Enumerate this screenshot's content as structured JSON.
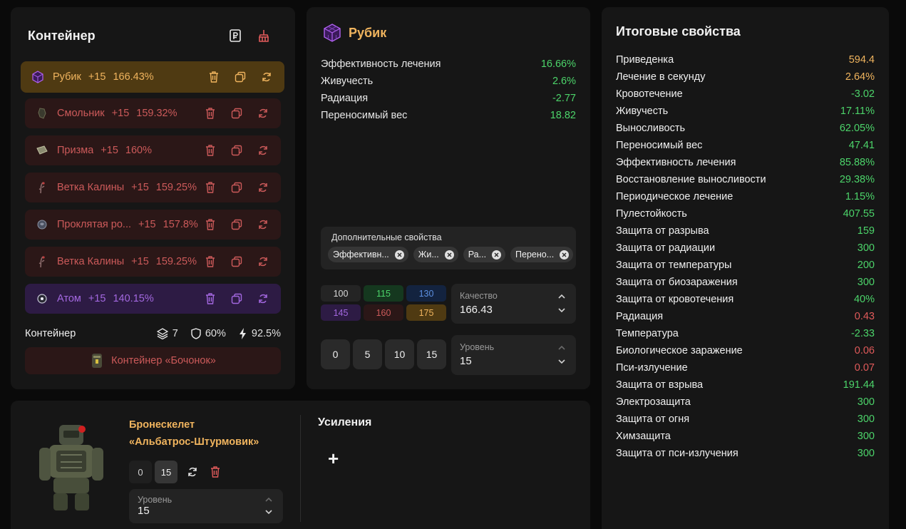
{
  "container": {
    "title": "Контейнер",
    "artifacts": [
      {
        "name": "Рубик",
        "level": "+15",
        "quality": "166.43%",
        "style": "sel",
        "icon": "cube-artifact-icon"
      },
      {
        "name": "Смольник",
        "level": "+15",
        "quality": "159.32%",
        "style": "red",
        "icon": "resin-artifact-icon"
      },
      {
        "name": "Призма",
        "level": "+15",
        "quality": "160%",
        "style": "red",
        "icon": "prism-artifact-icon"
      },
      {
        "name": "Ветка Калины",
        "level": "+15",
        "quality": "159.25%",
        "style": "red",
        "icon": "branch-artifact-icon"
      },
      {
        "name": "Проклятая ро...",
        "level": "+15",
        "quality": "157.8%",
        "style": "red",
        "icon": "cursed-rose-artifact-icon"
      },
      {
        "name": "Ветка Калины",
        "level": "+15",
        "quality": "159.25%",
        "style": "red",
        "icon": "branch-artifact-icon"
      },
      {
        "name": "Атом",
        "level": "+15",
        "quality": "140.15%",
        "style": "pur",
        "icon": "atom-artifact-icon"
      }
    ],
    "footer_label": "Контейнер",
    "stats": {
      "slots": "7",
      "protection": "60%",
      "efficiency": "92.5%"
    },
    "selected_container": "Контейнер «Бочонок»"
  },
  "artifact": {
    "title": "Рубик",
    "properties": [
      {
        "name": "Эффективность лечения",
        "value": "16.66%"
      },
      {
        "name": "Живучесть",
        "value": "2.6%"
      },
      {
        "name": "Радиация",
        "value": "-2.77"
      },
      {
        "name": "Переносимый вес",
        "value": "18.82"
      }
    ],
    "extra_label": "Дополнительные свойства",
    "extra_chips": [
      "Эффективн...",
      "Жи...",
      "Ра...",
      "Перено..."
    ],
    "quality_presets": [
      {
        "label": "100",
        "bg": "#242424",
        "fg": "#d8d8d8"
      },
      {
        "label": "115",
        "bg": "#15381f",
        "fg": "#4cd46a"
      },
      {
        "label": "130",
        "bg": "#13233f",
        "fg": "#5c8fe0"
      },
      {
        "label": "145",
        "bg": "#2d1b44",
        "fg": "#a368e0"
      },
      {
        "label": "160",
        "bg": "#2b1717",
        "fg": "#cc5a5a"
      },
      {
        "label": "175",
        "bg": "#4f3a12",
        "fg": "#f0b45e"
      }
    ],
    "quality_label": "Качество",
    "quality_value": "166.43",
    "level_presets": [
      "0",
      "5",
      "10",
      "15"
    ],
    "level_label": "Уровень",
    "level_value": "15"
  },
  "exo": {
    "name_line1": "Бронескелет",
    "name_line2": "«Альбатрос-Штурмовик»",
    "level_buttons": [
      "0",
      "15"
    ],
    "level_label": "Уровень",
    "level_value": "15",
    "boosts_title": "Усиления",
    "add_symbol": "+"
  },
  "totals": {
    "title": "Итоговые свойства",
    "rows": [
      {
        "name": "Приведенка",
        "value": "594.4",
        "color": "#f0b45e"
      },
      {
        "name": "Лечение в секунду",
        "value": "2.64%",
        "color": "#f0b45e"
      },
      {
        "name": "Кровотечение",
        "value": "-3.02",
        "color": "#4cd46a"
      },
      {
        "name": "Живучесть",
        "value": "17.11%",
        "color": "#4cd46a"
      },
      {
        "name": "Выносливость",
        "value": "62.05%",
        "color": "#4cd46a"
      },
      {
        "name": "Переносимый вес",
        "value": "47.41",
        "color": "#4cd46a"
      },
      {
        "name": "Эффективность лечения",
        "value": "85.88%",
        "color": "#4cd46a"
      },
      {
        "name": "Восстановление выносливости",
        "value": "29.38%",
        "color": "#4cd46a"
      },
      {
        "name": "Периодическое лечение",
        "value": "1.15%",
        "color": "#4cd46a"
      },
      {
        "name": "Пулестойкость",
        "value": "407.55",
        "color": "#4cd46a"
      },
      {
        "name": "Защита от разрыва",
        "value": "159",
        "color": "#4cd46a"
      },
      {
        "name": "Защита от радиации",
        "value": "300",
        "color": "#4cd46a"
      },
      {
        "name": "Защита от температуры",
        "value": "200",
        "color": "#4cd46a"
      },
      {
        "name": "Защита от биозаражения",
        "value": "300",
        "color": "#4cd46a"
      },
      {
        "name": "Защита от кровотечения",
        "value": "40%",
        "color": "#4cd46a"
      },
      {
        "name": "Радиация",
        "value": "0.43",
        "color": "#e05a5a"
      },
      {
        "name": "Температура",
        "value": "-2.33",
        "color": "#4cd46a"
      },
      {
        "name": "Биологическое заражение",
        "value": "0.06",
        "color": "#e05a5a"
      },
      {
        "name": "Пси-излучение",
        "value": "0.07",
        "color": "#e05a5a"
      },
      {
        "name": "Защита от взрыва",
        "value": "191.44",
        "color": "#4cd46a"
      },
      {
        "name": "Электрозащита",
        "value": "300",
        "color": "#4cd46a"
      },
      {
        "name": "Защита от огня",
        "value": "300",
        "color": "#4cd46a"
      },
      {
        "name": "Химзащита",
        "value": "300",
        "color": "#4cd46a"
      },
      {
        "name": "Защита от пси-излучения",
        "value": "300",
        "color": "#4cd46a"
      }
    ]
  }
}
